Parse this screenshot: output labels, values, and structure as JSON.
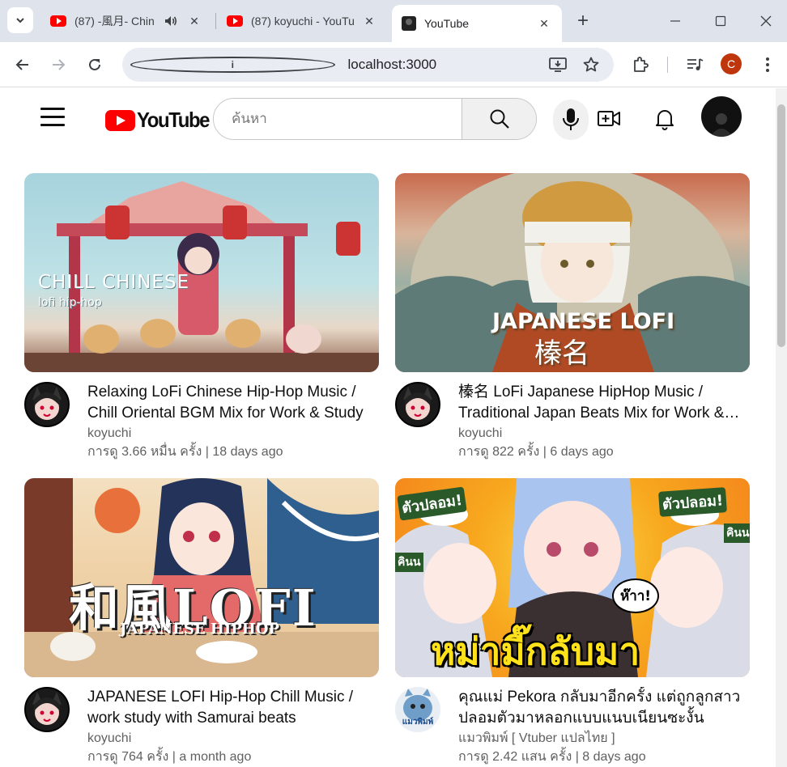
{
  "browser": {
    "tabs": [
      {
        "title": "(87) -風月- Chin",
        "active": false,
        "audio": true
      },
      {
        "title": "(87) koyuchi - YouTu",
        "active": false,
        "audio": false
      },
      {
        "title": "YouTube",
        "active": true,
        "audio": false
      }
    ],
    "new_tab_label": "+",
    "url": "localhost:3000",
    "profile_initial": "C"
  },
  "header": {
    "logo_text": "YouTube",
    "search_placeholder": "ค้นหา"
  },
  "videos": [
    {
      "title": "Relaxing LoFi Chinese Hip-Hop Music / Chill Oriental BGM Mix for Work & Study",
      "channel": "koyuchi",
      "stats": "การดู 3.66 หมื่น ครั้ง | 18 days ago",
      "thumb_text_main": "CHILL CHINESE",
      "thumb_text_sub": "lofi hip-hop"
    },
    {
      "title": "榛名 LoFi Japanese HipHop Music / Traditional Japan Beats Mix for Work & Study",
      "channel": "koyuchi",
      "stats": "การดู 822 ครั้ง | 6 days ago",
      "thumb_text_main": "JAPANESE LOFI",
      "thumb_text_sub": "榛名"
    },
    {
      "title": "JAPANESE LOFI Hip-Hop Chill Music / work study with Samurai beats",
      "channel": "koyuchi",
      "stats": "การดู 764 ครั้ง | a month ago",
      "thumb_text_main": "和風LOFI",
      "thumb_text_sub": "JAPANESE HIPHOP"
    },
    {
      "title": "คุณแม่ Pekora กลับมาอีกครั้ง แต่ถูกลูกสาวปลอมตัวมาหลอกแบบแนบเนียนซะงั้น",
      "channel": "แมวพิมพ์ [ Vtuber แปลไทย ]",
      "stats": "การดู 2.42 แสน ครั้ง | 8 days ago",
      "thumb_text_main": "หม่ามี๊กลับมา",
      "thumb_text_sub": "ตัวปลอม!",
      "thumb_text_sub2": "ห๊าา!",
      "thumb_text_sub3": "คินน",
      "avatar_text": "แมวพิมพ์"
    }
  ],
  "colors": {
    "brand_red": "#ff0000",
    "secondary_text": "#606060",
    "tabstrip_bg": "#dfe3eb"
  }
}
